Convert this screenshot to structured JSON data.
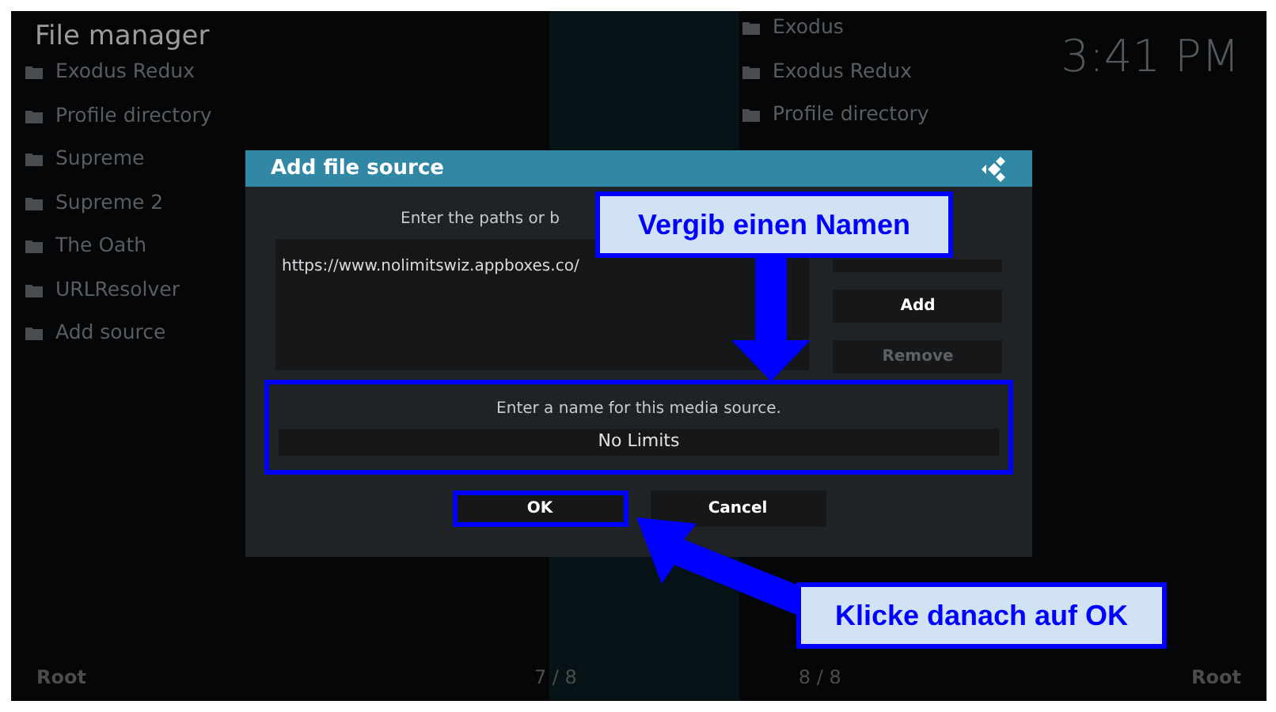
{
  "header": {
    "title": "File manager",
    "clock": "3:41 PM"
  },
  "left_list": [
    {
      "label": "Exodus Redux"
    },
    {
      "label": "Profile directory"
    },
    {
      "label": "Supreme"
    },
    {
      "label": "Supreme 2"
    },
    {
      "label": "The Oath"
    },
    {
      "label": "URLResolver"
    },
    {
      "label": "Add source"
    }
  ],
  "right_list": [
    {
      "label": "Exodus"
    },
    {
      "label": "Exodus Redux"
    },
    {
      "label": "Profile directory"
    }
  ],
  "dialog": {
    "title": "Add file source",
    "prompt": "Enter the paths or b",
    "paths": [
      "https://www.nolimitswiz.appboxes.co/"
    ],
    "side_buttons": [
      {
        "label": "Add",
        "disabled": false
      },
      {
        "label": "Remove",
        "disabled": true
      }
    ],
    "name_prompt": "Enter a name for this media source.",
    "name_value": "No Limits",
    "buttons": [
      {
        "label": "OK",
        "selected": true
      },
      {
        "label": "Cancel",
        "selected": false
      }
    ]
  },
  "annotations": [
    {
      "text": "Vergib einen Namen"
    },
    {
      "text": "Klicke danach auf OK"
    }
  ],
  "footer": {
    "left": "Root",
    "page_left": "7 / 8",
    "page_right": "8 / 8",
    "right": "Root"
  }
}
